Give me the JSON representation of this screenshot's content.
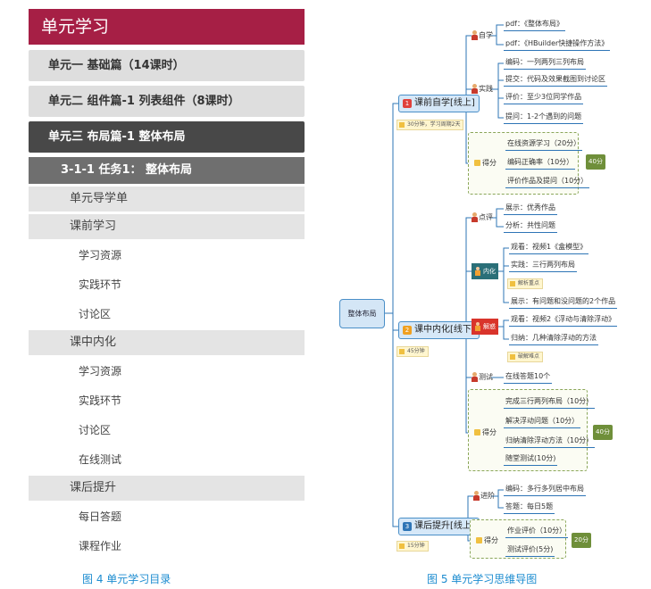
{
  "directory": {
    "header": "单元学习",
    "unit1": "单元一 基础篇（14课时）",
    "unit2": "单元二 组件篇-1 列表组件（8课时）",
    "unit3": "单元三 布局篇-1 整体布局",
    "task": "3-1-1 任务1：  整体布局",
    "guide": "单元导学单",
    "pre": {
      "title": "课前学习",
      "items": [
        "学习资源",
        "实践环节",
        "讨论区"
      ]
    },
    "mid": {
      "title": "课中内化",
      "items": [
        "学习资源",
        "实践环节",
        "讨论区",
        "在线测试"
      ]
    },
    "post": {
      "title": "课后提升",
      "items": [
        "每日答题",
        "课程作业"
      ]
    }
  },
  "captions": {
    "fig4": "图 4   单元学习目录",
    "fig5": "图 5 单元学习思维导图"
  },
  "mindmap": {
    "root": "整体布局",
    "colors": {
      "line": "#2e75b6",
      "stage1": "#e0413c",
      "stage2": "#f0a020",
      "stage3": "#2e75b6",
      "teal": "#2a6f78",
      "red": "#d9342b",
      "green": "#6f8f3a"
    },
    "stage1": {
      "num": "1",
      "label": "课前自学[线上]",
      "note": "30分钟，学习周期2天",
      "zixue": {
        "label": "自学",
        "items": [
          "pdf：《整体布局》",
          "pdf：《HBuilder快捷操作方法》"
        ]
      },
      "shijian": {
        "label": "实践",
        "items": [
          "编码：一列两列三列布局",
          "提交：代码及效果截图到讨论区",
          "评价：至少3位同学作品",
          "提问：1-2个遇到的问题"
        ]
      },
      "defen": {
        "label": "得分",
        "items": [
          "在线资源学习（20分）",
          "编码正确率（10分）",
          "评价作品及提问（10分）"
        ],
        "total": "40分"
      }
    },
    "stage2": {
      "num": "2",
      "label": "课中内化[线下]",
      "note": "45分钟",
      "dianping": {
        "label": "点评",
        "items": [
          "展示：优秀作品",
          "分析：共性问题"
        ]
      },
      "neihua": {
        "label": "内化",
        "items": [
          "观看：视频1《盒模型》",
          "实践：三行两列布局",
          "展示：有问题和没问题的2个作品"
        ],
        "tag": "解析重点"
      },
      "jiehuo": {
        "label": "解惑",
        "items": [
          "观看：视频2《浮动与清除浮动》",
          "归纳：几种清除浮动的方法"
        ],
        "tag": "破解难点"
      },
      "ceshi": {
        "label": "测试",
        "items": [
          "在线答题10个"
        ]
      },
      "defen": {
        "label": "得分",
        "items": [
          "完成三行两列布局（10分）",
          "解决浮动问题（10分）",
          "归纳清除浮动方法（10分）",
          "随堂测试(10分)"
        ],
        "total": "40分"
      }
    },
    "stage3": {
      "num": "3",
      "label": "课后提升[线上]",
      "note": "15分钟",
      "jinjie": {
        "label": "进阶",
        "items": [
          "编码：多行多列居中布局",
          "答题：每日5题"
        ]
      },
      "defen": {
        "label": "得分",
        "items": [
          "作业评价（10分）",
          "测试评价(5分)"
        ],
        "total": "20分"
      }
    }
  }
}
